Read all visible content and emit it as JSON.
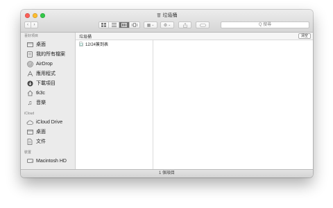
{
  "window": {
    "title": "垃圾桶"
  },
  "toolbar": {
    "back_icon": "chevron-left-icon",
    "forward_icon": "chevron-right-icon",
    "view_modes": [
      "icon-view",
      "list-view",
      "column-view",
      "cover-flow-view"
    ],
    "active_view": "column-view",
    "search_placeholder": "Q 搜尋"
  },
  "sidebar": {
    "sections": [
      {
        "label": "喜好項目",
        "items": [
          {
            "label": "桌面",
            "icon": "desktop-icon"
          },
          {
            "label": "我的所有檔案",
            "icon": "all-files-icon"
          },
          {
            "label": "AirDrop",
            "icon": "airdrop-icon"
          },
          {
            "label": "應用程式",
            "icon": "applications-icon"
          },
          {
            "label": "下載項目",
            "icon": "downloads-icon"
          },
          {
            "label": "tk3c",
            "icon": "home-icon"
          },
          {
            "label": "音樂",
            "icon": "music-icon"
          }
        ]
      },
      {
        "label": "iCloud",
        "items": [
          {
            "label": "iCloud Drive",
            "icon": "cloud-icon"
          },
          {
            "label": "桌面",
            "icon": "desktop-icon"
          },
          {
            "label": "文件",
            "icon": "documents-icon"
          }
        ]
      },
      {
        "label": "裝置",
        "items": [
          {
            "label": "Macintosh HD",
            "icon": "hard-drive-icon"
          }
        ]
      }
    ]
  },
  "pathbar": {
    "label": "垃圾桶",
    "empty_button": "清空"
  },
  "files": [
    {
      "name": "12/24簽到表",
      "icon": "spreadsheet-file-icon"
    }
  ],
  "status": {
    "text": "1 個項目"
  },
  "colors": {
    "close": "#fc5f57",
    "minimize": "#fdbc2e",
    "maximize": "#33c748",
    "active_segment": "#6d6d6d",
    "sidebar_bg": "#ebebeb"
  }
}
